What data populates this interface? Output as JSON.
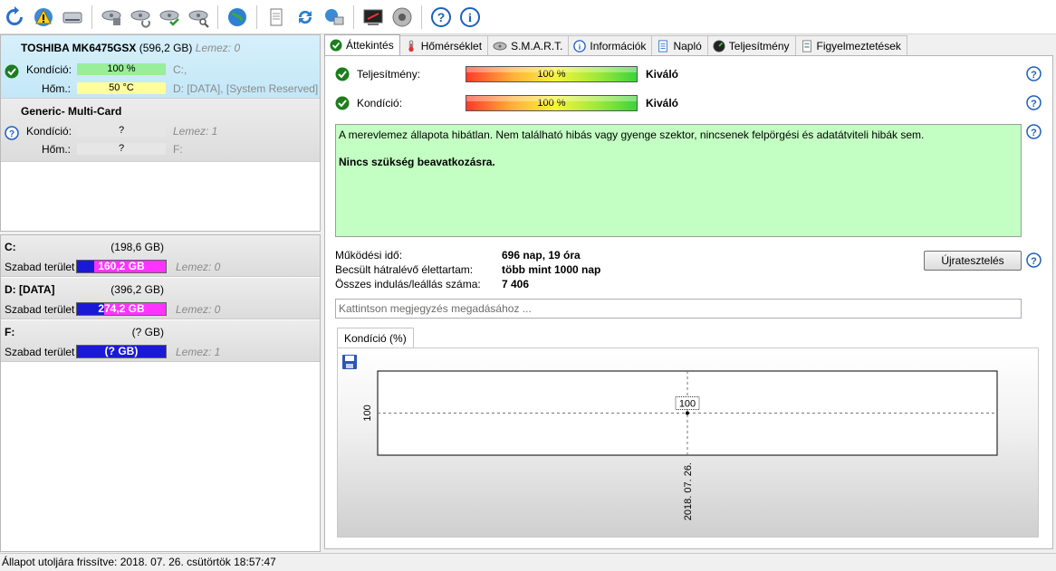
{
  "toolbar": {
    "icons": [
      "refresh-icon",
      "warning-globe-icon",
      "drive-icon",
      "disk-settings-icon",
      "disk-refresh-icon",
      "disk-check-icon",
      "disk-search-icon",
      "globe-icon",
      "document-icon",
      "sync-icon",
      "network-icon",
      "terminal-icon",
      "speaker-icon",
      "help-icon",
      "info-icon"
    ]
  },
  "disks": [
    {
      "name": "TOSHIBA MK6475GSX",
      "capacity": "(596,2 GB)",
      "lemez": "Lemez: 0",
      "condition_label": "Kondíció:",
      "condition_value": "100 %",
      "condition_color": "#99ee99",
      "letters": "C:,",
      "temp_label": "Hőm.:",
      "temp_value": "50 °C",
      "temp_color": "#ffff99",
      "partitions": "D: [DATA],  [System Reserved]",
      "status": "ok"
    },
    {
      "name": "Generic- Multi-Card",
      "capacity": "",
      "lemez": "",
      "condition_label": "Kondíció:",
      "condition_value": "?",
      "condition_color": "#e6e6e6",
      "letters": "Lemez: 1",
      "temp_label": "Hőm.:",
      "temp_value": "?",
      "temp_color": "#e6e6e6",
      "partitions": "F:",
      "status": "unknown"
    }
  ],
  "volumes": [
    {
      "name": "C:",
      "size": "(198,6 GB)",
      "free_label": "Szabad terület",
      "free_value": "160,2 GB",
      "used_fraction": 0.19,
      "lemez": "Lemez: 0"
    },
    {
      "name": "D: [DATA]",
      "size": "(396,2 GB)",
      "free_label": "Szabad terület",
      "free_value": "274,2 GB",
      "used_fraction": 0.31,
      "lemez": "Lemez: 0"
    },
    {
      "name": "F:",
      "size": "(? GB)",
      "free_label": "Szabad terület",
      "free_value": "(? GB)",
      "used_fraction": 1.0,
      "lemez": "Lemez: 1"
    }
  ],
  "tabs": [
    {
      "label": "Áttekintés",
      "icon": "check-icon",
      "active": true
    },
    {
      "label": "Hőmérséklet",
      "icon": "thermometer-icon",
      "active": false
    },
    {
      "label": "S.M.A.R.T.",
      "icon": "smart-icon",
      "active": false
    },
    {
      "label": "Információk",
      "icon": "info-icon",
      "active": false
    },
    {
      "label": "Napló",
      "icon": "log-icon",
      "active": false
    },
    {
      "label": "Teljesítmény",
      "icon": "gauge-icon",
      "active": false
    },
    {
      "label": "Figyelmeztetések",
      "icon": "alert-doc-icon",
      "active": false
    }
  ],
  "overview": {
    "performance_label": "Teljesítmény:",
    "performance_value": "100 %",
    "performance_verdict": "Kiváló",
    "condition_label": "Kondíció:",
    "condition_value": "100 %",
    "condition_verdict": "Kiváló",
    "message_line1": "A merevlemez állapota hibátlan. Nem található hibás vagy gyenge szektor, nincsenek felpörgési és adatátviteli hibák sem.",
    "message_line2": "Nincs szükség beavatkozásra.",
    "message_bg": "#c3ffc3",
    "uptime_label": "Működési idő:",
    "uptime_value": "696 nap, 19 óra",
    "lifetime_label": "Becsült hátralévő élettartam:",
    "lifetime_value": "több mint 1000 nap",
    "starts_label": "Összes indulás/leállás száma:",
    "starts_value": "7 406",
    "retest_label": "Újratesztelés",
    "note_placeholder": "Kattintson megjegyzés megadásához ..."
  },
  "chart_tab_label": "Kondíció  (%)",
  "chart_data": {
    "type": "line",
    "x": [
      "2018. 07. 26."
    ],
    "series": [
      {
        "values": [
          100
        ]
      }
    ],
    "y_tick_labels": [
      "100"
    ],
    "data_labels": [
      "100"
    ],
    "grid": true
  },
  "statusbar": {
    "text": "Állapot utoljára frissítve: 2018. 07. 26. csütörtök 18:57:47"
  }
}
